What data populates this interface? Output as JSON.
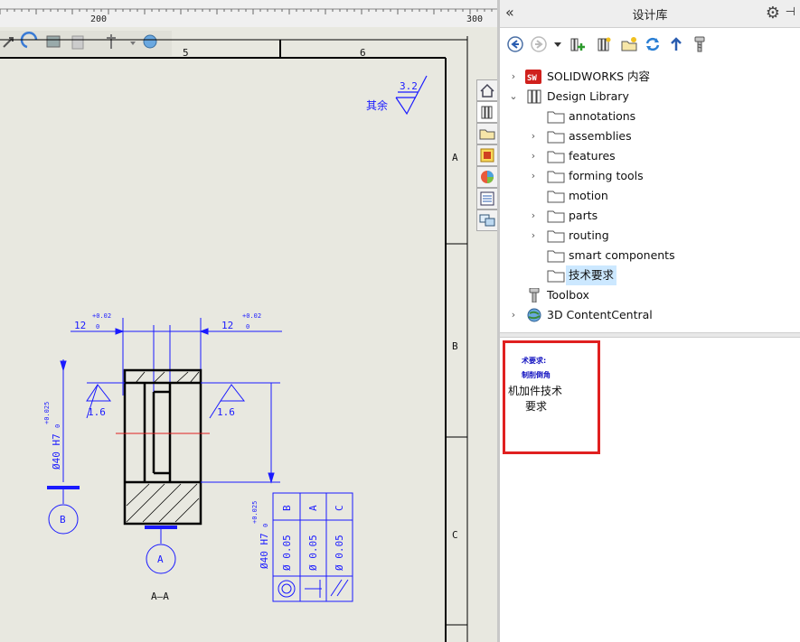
{
  "ruler": {
    "ticks": [
      "200",
      "300"
    ]
  },
  "sheet": {
    "zone_columns": [
      "5",
      "6"
    ],
    "zone_rows": [
      "A",
      "B",
      "C"
    ],
    "roughness": {
      "label": "其余",
      "value": "3.2"
    }
  },
  "part_drawing": {
    "dim_left": {
      "value": "12",
      "tol_upper": "+0.02",
      "tol_lower": "0"
    },
    "dim_right": {
      "value": "12",
      "tol_upper": "+0.02",
      "tol_lower": "0"
    },
    "roughness_left": "1.6",
    "roughness_right": "1.6",
    "diameter": "Ø40 H7",
    "diameter_tol_upper": "+0.025",
    "diameter_tol_lower": "0",
    "datum_a": "A",
    "datum_b": "B",
    "section_label": "A–A"
  },
  "tolerance_table": {
    "diameter": "Ø40 H7",
    "tol_upper": "+0.025",
    "tol_lower": "0",
    "columns": [
      {
        "datum": "B",
        "value": "Ø 0.05",
        "symbol": "circular-runout"
      },
      {
        "datum": "A",
        "value": "Ø 0.05",
        "symbol": "perpendicularity"
      },
      {
        "datum": "C",
        "value": "Ø 0.05",
        "symbol": "parallelism"
      }
    ]
  },
  "taskpane": {
    "title": "设计库",
    "tree": [
      {
        "label": "SOLIDWORKS 内容",
        "expanded": false
      },
      {
        "label": "Design Library",
        "expanded": true
      },
      {
        "label": "annotations"
      },
      {
        "label": "assemblies"
      },
      {
        "label": "features"
      },
      {
        "label": "forming tools"
      },
      {
        "label": "motion"
      },
      {
        "label": "parts"
      },
      {
        "label": "routing"
      },
      {
        "label": "smart components"
      },
      {
        "label": "技术要求",
        "selected": true
      },
      {
        "label": "Toolbox"
      },
      {
        "label": "3D ContentCentral"
      }
    ],
    "preview": {
      "line1": "术要求:",
      "line2": "制削倒角",
      "name_line1": "机加件技术",
      "name_line2": "要求"
    }
  },
  "colors": {
    "drawing_blue": "#1a1aff",
    "highlight": "#e02020",
    "selection": "#cce8ff"
  }
}
